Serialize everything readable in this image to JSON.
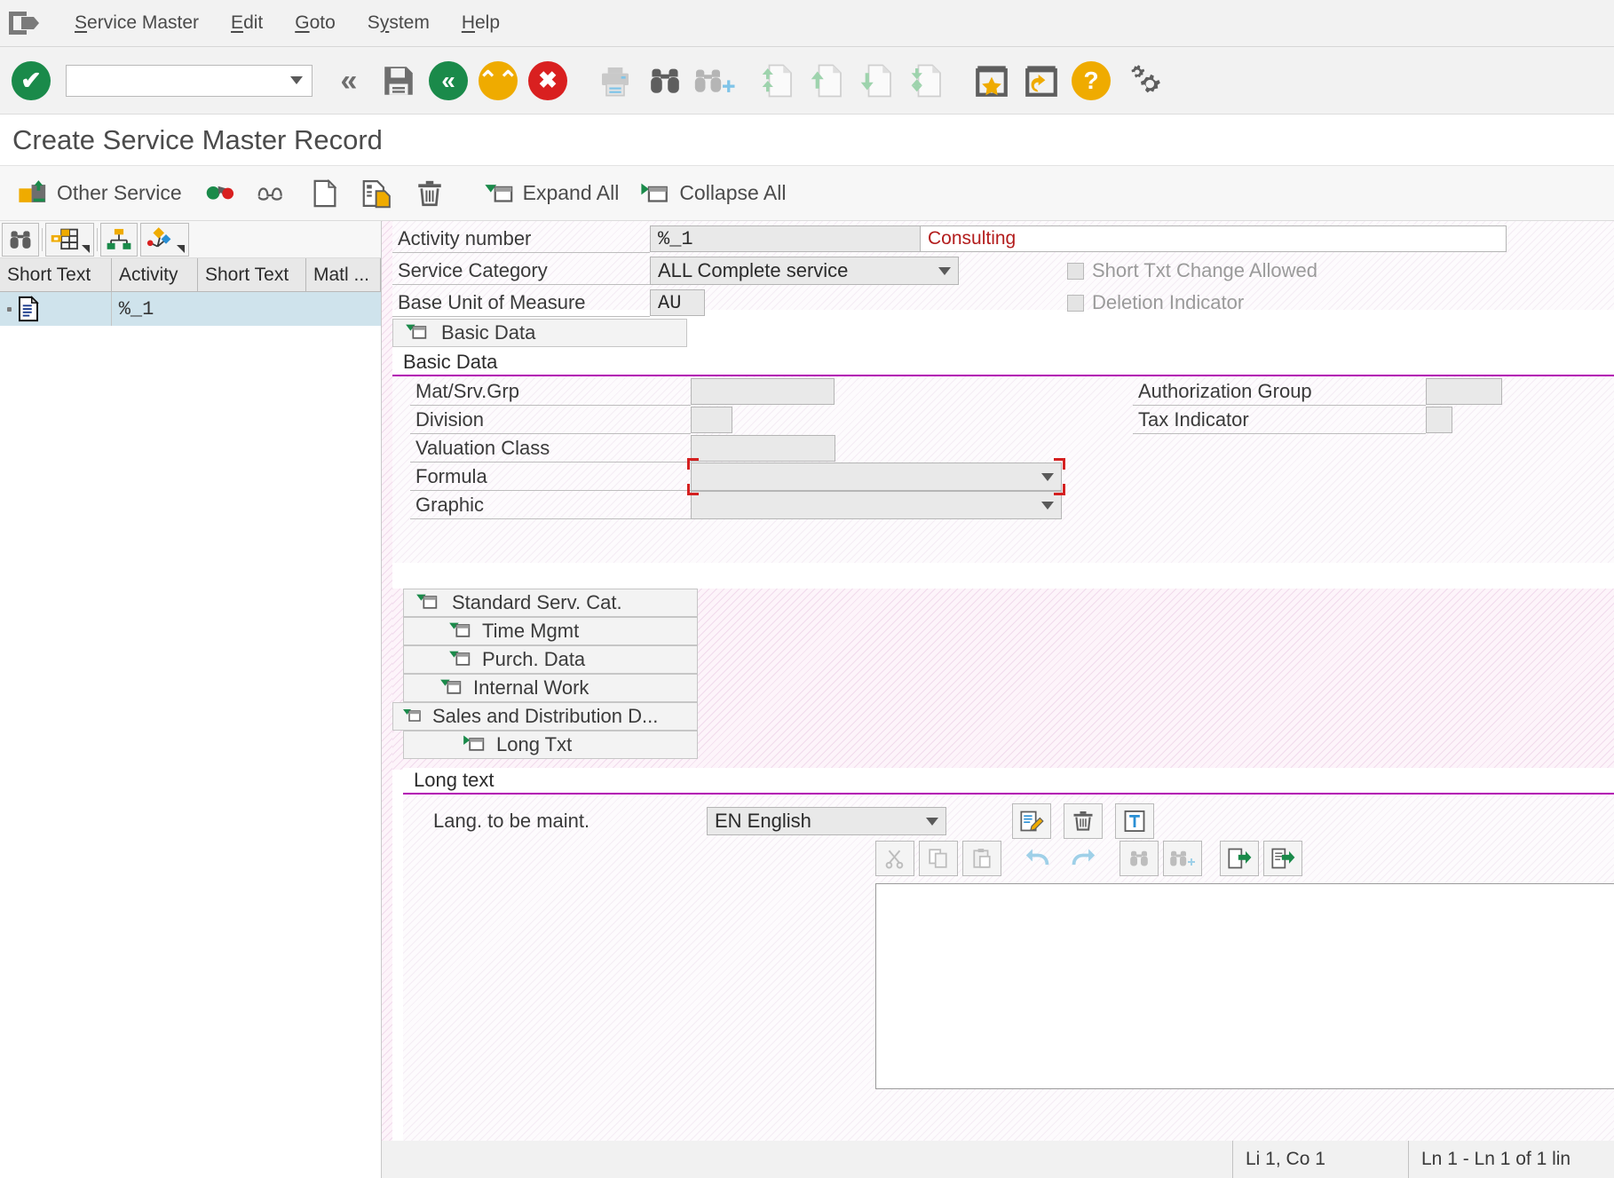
{
  "menu": {
    "items": [
      {
        "label": "Service Master",
        "accel": "S"
      },
      {
        "label": "Edit",
        "accel": "E"
      },
      {
        "label": "Goto",
        "accel": "G"
      },
      {
        "label": "System",
        "accel": "y"
      },
      {
        "label": "Help",
        "accel": "H"
      }
    ]
  },
  "system_toolbar": {
    "command_field_value": "",
    "command_field_placeholder": "",
    "buttons": [
      {
        "name": "enter-button",
        "icon": "green-check-icon",
        "tooltip": "Enter"
      },
      {
        "name": "back-button",
        "icon": "double-chevron-left-icon",
        "tooltip": "Back"
      },
      {
        "name": "save-button",
        "icon": "save-floppy-icon",
        "tooltip": "Save"
      },
      {
        "name": "green-back-button",
        "icon": "green-back-icon",
        "tooltip": "Back"
      },
      {
        "name": "exit-button",
        "icon": "orange-up-icon",
        "tooltip": "Exit"
      },
      {
        "name": "cancel-button",
        "icon": "red-cancel-icon",
        "tooltip": "Cancel"
      },
      {
        "name": "print-button",
        "icon": "printer-icon",
        "tooltip": "Print"
      },
      {
        "name": "find-button",
        "icon": "binoculars-icon",
        "tooltip": "Find"
      },
      {
        "name": "find-next-button",
        "icon": "binoculars-plus-icon",
        "tooltip": "Find Next"
      },
      {
        "name": "first-page-button",
        "icon": "page-first-icon",
        "tooltip": "First Page"
      },
      {
        "name": "previous-page-button",
        "icon": "page-up-icon",
        "tooltip": "Previous Page"
      },
      {
        "name": "next-page-button",
        "icon": "page-down-icon",
        "tooltip": "Next Page"
      },
      {
        "name": "last-page-button",
        "icon": "page-last-icon",
        "tooltip": "Last Page"
      },
      {
        "name": "favorites-button",
        "icon": "star-box-icon",
        "tooltip": "Create Shortcut"
      },
      {
        "name": "new-session-button",
        "icon": "arrow-box-icon",
        "tooltip": "Create New Session"
      },
      {
        "name": "help-button",
        "icon": "orange-question-icon",
        "tooltip": "Help"
      },
      {
        "name": "customize-button",
        "icon": "gears-icon",
        "tooltip": "Customize Local Layout"
      }
    ]
  },
  "title": "Create Service Master Record",
  "app_toolbar": {
    "other_service_label": "Other Service",
    "expand_all_label": "Expand All",
    "collapse_all_label": "Collapse All",
    "buttons": [
      {
        "name": "other-service-button",
        "icon": "folder-import-icon"
      },
      {
        "name": "display-change-button",
        "icon": "green-dot-arrow-icon"
      },
      {
        "name": "display-mode-button",
        "icon": "glasses-icon"
      },
      {
        "name": "new-entry-button",
        "icon": "blank-page-icon"
      },
      {
        "name": "copy-entry-button",
        "icon": "copy-page-icon"
      },
      {
        "name": "delete-entry-button",
        "icon": "trash-icon"
      },
      {
        "name": "expand-all-button",
        "icon": "expand-all-icon"
      },
      {
        "name": "collapse-all-button",
        "icon": "collapse-all-icon"
      }
    ]
  },
  "tree": {
    "toolbar_buttons": [
      {
        "name": "tree-find-button",
        "icon": "binoculars-icon"
      },
      {
        "name": "tree-filter-button",
        "icon": "filter-grid-icon",
        "has_dropdown": true
      },
      {
        "name": "tree-hierarchy-button",
        "icon": "hierarchy-icon"
      },
      {
        "name": "tree-graph-button",
        "icon": "diamond-graph-icon",
        "has_dropdown": true
      }
    ],
    "columns": [
      "Short Text",
      "Activity",
      "Short Text",
      "Matl ..."
    ],
    "rows": [
      {
        "icon": "document-icon",
        "short_text": "",
        "activity": "%_1",
        "short_text2": "",
        "matl": "",
        "selected": true
      }
    ]
  },
  "form": {
    "header_fields": [
      {
        "label": "Activity number",
        "value": "%_1",
        "mono": true
      },
      {
        "label": "Service Category",
        "value": "ALL Complete service",
        "dropdown": true
      },
      {
        "label": "Base Unit of Measure",
        "value": "AU",
        "mono": true
      }
    ],
    "description_value": "Consulting",
    "description_color": "#b31d1d",
    "checkboxes": [
      {
        "label": "Short Txt Change Allowed",
        "checked": false,
        "disabled": true
      },
      {
        "label": "Deletion Indicator",
        "checked": false,
        "disabled": true
      }
    ],
    "basic_data_tab_label": "Basic Data",
    "basic_data_group_label": "Basic Data",
    "group_underline_color": "#b300b3",
    "basic_data_fields_left": [
      {
        "label": "Mat/Srv.Grp",
        "value": "",
        "width": "wide"
      },
      {
        "label": "Division",
        "value": "",
        "width": "narrow"
      },
      {
        "label": "Valuation Class",
        "value": "",
        "width": "wide"
      },
      {
        "label": "Formula",
        "value": "",
        "width": "full",
        "dropdown": true,
        "focused": true
      },
      {
        "label": "Graphic",
        "value": "",
        "width": "full",
        "dropdown": true
      }
    ],
    "basic_data_fields_right": [
      {
        "label": "Authorization Group",
        "value": "",
        "width": "med"
      },
      {
        "label": "Tax Indicator",
        "value": "",
        "width": "tiny"
      }
    ],
    "section_tabs": [
      {
        "label": "Standard Serv. Cat.",
        "indent": 0
      },
      {
        "label": "Time Mgmt",
        "indent": 1
      },
      {
        "label": "Purch. Data",
        "indent": 1
      },
      {
        "label": "Internal Work",
        "indent": 1
      },
      {
        "label": "Sales and Distribution D...",
        "indent": -1
      },
      {
        "label": "Long Txt",
        "indent": 2
      }
    ]
  },
  "long_text": {
    "group_label": "Long text",
    "language_label": "Lang. to be maint.",
    "language_value": "EN English",
    "editor_toolbar": [
      {
        "name": "lt-edit-button",
        "icon": "edit-pencil-icon"
      },
      {
        "name": "lt-delete-button",
        "icon": "trash-icon"
      },
      {
        "name": "lt-text-button",
        "icon": "text-t-icon"
      }
    ],
    "format_toolbar": [
      {
        "name": "lt-cut-button",
        "icon": "scissors-icon",
        "disabled": true
      },
      {
        "name": "lt-copy-button",
        "icon": "copy-icon",
        "disabled": true
      },
      {
        "name": "lt-paste-button",
        "icon": "paste-icon",
        "disabled": true
      },
      {
        "name": "lt-undo-button",
        "icon": "undo-arrow-icon"
      },
      {
        "name": "lt-redo-button",
        "icon": "redo-arrow-icon"
      },
      {
        "name": "lt-find-button",
        "icon": "binoculars-icon",
        "disabled": true
      },
      {
        "name": "lt-find-next-button",
        "icon": "binoculars-plus-icon",
        "disabled": true
      },
      {
        "name": "lt-insert-line-button",
        "icon": "insert-right-icon"
      },
      {
        "name": "lt-goto-line-button",
        "icon": "goto-right-icon"
      }
    ],
    "content": "",
    "status_left": "Li 1, Co 1",
    "status_right": "Ln 1 - Ln 1 of 1 lin"
  }
}
